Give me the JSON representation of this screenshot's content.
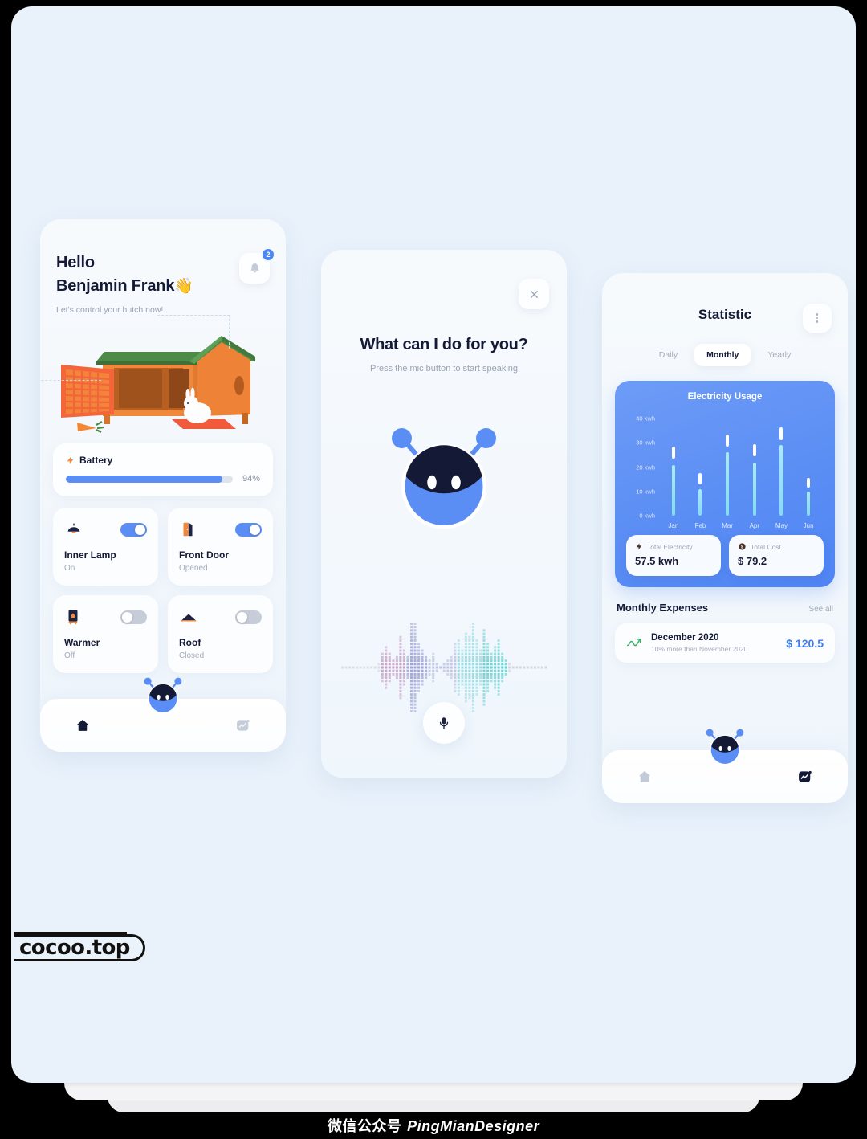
{
  "screen1": {
    "greeting_line1": "Hello",
    "greeting_line2": "Benjamin Frank",
    "wave_emoji": "👋",
    "subtitle": "Let's control your hutch now!",
    "notification_count": "2",
    "battery": {
      "label": "Battery",
      "percent_label": "94%",
      "percent": 94
    },
    "controls": [
      {
        "name": "Inner Lamp",
        "state": "On",
        "toggle": "on",
        "icon": "lamp-icon"
      },
      {
        "name": "Front Door",
        "state": "Opened",
        "toggle": "on",
        "icon": "door-icon"
      },
      {
        "name": "Warmer",
        "state": "Off",
        "toggle": "off",
        "icon": "heater-icon"
      },
      {
        "name": "Roof",
        "state": "Closed",
        "toggle": "off",
        "icon": "roof-icon"
      }
    ],
    "nav": {
      "home": "home-icon",
      "assistant": "robot-icon",
      "stats": "chart-icon"
    }
  },
  "screen2": {
    "title": "What can I do for you?",
    "subtitle": "Press the mic button to start speaking",
    "close_icon": "close-icon",
    "mic_icon": "microphone-icon"
  },
  "screen3": {
    "title": "Statistic",
    "more_icon": "kebab-menu-icon",
    "tabs": [
      {
        "label": "Daily",
        "active": false
      },
      {
        "label": "Monthly",
        "active": true
      },
      {
        "label": "Yearly",
        "active": false
      }
    ],
    "stats": [
      {
        "label": "Total Electricity",
        "value": "57.5 kwh",
        "icon": "bolt-icon"
      },
      {
        "label": "Total Cost",
        "value": "$ 79.2",
        "icon": "coin-icon"
      }
    ],
    "expenses": {
      "heading": "Monthly Expenses",
      "see_all": "See all",
      "items": [
        {
          "month": "December 2020",
          "note": "10% more than November 2020",
          "amount": "$ 120.5",
          "trend_icon": "trend-up-icon"
        }
      ]
    },
    "chart_data": {
      "type": "bar",
      "title": "Electricity Usage",
      "categories": [
        "Jan",
        "Feb",
        "Mar",
        "Apr",
        "May",
        "Jun"
      ],
      "values": [
        21,
        11,
        26,
        22,
        29,
        10
      ],
      "cap_tops": [
        28.5,
        17.5,
        33.5,
        29.5,
        36.5,
        15.5
      ],
      "cap_bottoms": [
        23.5,
        13.0,
        28.5,
        24.5,
        31.0,
        11.5
      ],
      "ytick_labels": [
        "40 kwh",
        "30 kwh",
        "20 kwh",
        "10 kwh",
        "0 kwh"
      ],
      "ytick_values": [
        40,
        30,
        20,
        10,
        0
      ],
      "ylim": [
        0,
        43
      ],
      "xlabel": "",
      "ylabel": "kwh",
      "grid": false,
      "legend": "none",
      "series": [
        {
          "name": "Electricity Usage",
          "values": [
            21,
            11,
            26,
            22,
            29,
            10
          ]
        }
      ]
    }
  },
  "branding": {
    "logo": "cocoo.top",
    "watermark_cn": "微信公众号 ",
    "watermark_en": "PingMianDesigner"
  },
  "colors": {
    "accent": "#5b8ef4",
    "dark": "#141a35",
    "muted": "#a3abba",
    "background": "#e9f2fb",
    "chart_bar": "#84dced"
  }
}
